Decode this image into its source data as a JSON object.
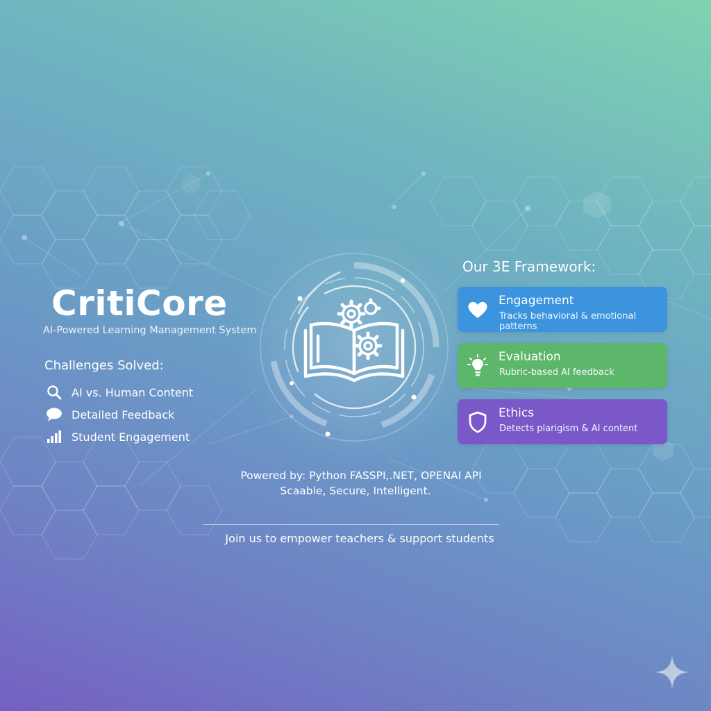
{
  "brand": {
    "title": "CritiCore",
    "subtitle": "AI-Powered Learning Management System"
  },
  "challenges": {
    "heading": "Challenges Solved:",
    "items": [
      {
        "label": "AI vs. Human Content",
        "icon": "search-icon"
      },
      {
        "label": "Detailed Feedback",
        "icon": "speech-bubble-icon"
      },
      {
        "label": "Student Engagement",
        "icon": "bar-chart-icon"
      }
    ]
  },
  "framework": {
    "heading": "Our 3E Framework:",
    "cards": [
      {
        "title": "Engagement",
        "description": "Tracks behavioral & emotional patterns",
        "icon": "heart-icon",
        "color": "#3b94dd"
      },
      {
        "title": "Evaluation",
        "description": "Rubric-based AI feedback",
        "icon": "lightbulb-icon",
        "color": "#5db76b"
      },
      {
        "title": "Ethics",
        "description": "Detects plarigism & AI content",
        "icon": "shield-icon",
        "color": "#7a58c8"
      }
    ]
  },
  "footer": {
    "powered_by": "Powered by: Python FASSPI,.NET, OPENAI API",
    "tagline": "Scaable, Secure, Intelligent.",
    "cta": "Join us to empower teachers & support students"
  },
  "logo": {
    "icon": "book-gears-icon"
  },
  "corner": {
    "icon": "sparkle-icon"
  }
}
